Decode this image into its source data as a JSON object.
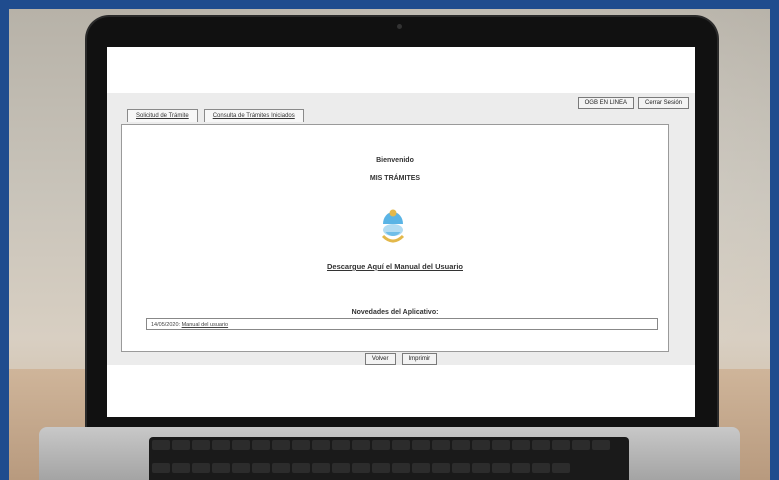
{
  "app": {
    "top_buttons": [
      "OGB EN LINEA",
      "Cerrar Sesión"
    ],
    "tabs": [
      "Solicitud de Trámite",
      "Consulta de Trámites Iniciados"
    ],
    "welcome": "Bienvenido",
    "app_name": "MIS TRÁMITES",
    "manual_link": "Descargue Aquí el Manual del Usuario",
    "news_title": "Novedades del Aplicativo:",
    "news_item": {
      "date": "14/05/2020:",
      "link": "Manual del usuario"
    },
    "bottom_buttons": [
      "Volver",
      "Imprimir"
    ]
  },
  "colors": {
    "border_frame": "#1f4c8e",
    "emblem_blue": "#5ab4e5",
    "emblem_gold": "#e3b84a"
  },
  "icons": {
    "emblem": "provincial-coat-of-arms-icon"
  }
}
